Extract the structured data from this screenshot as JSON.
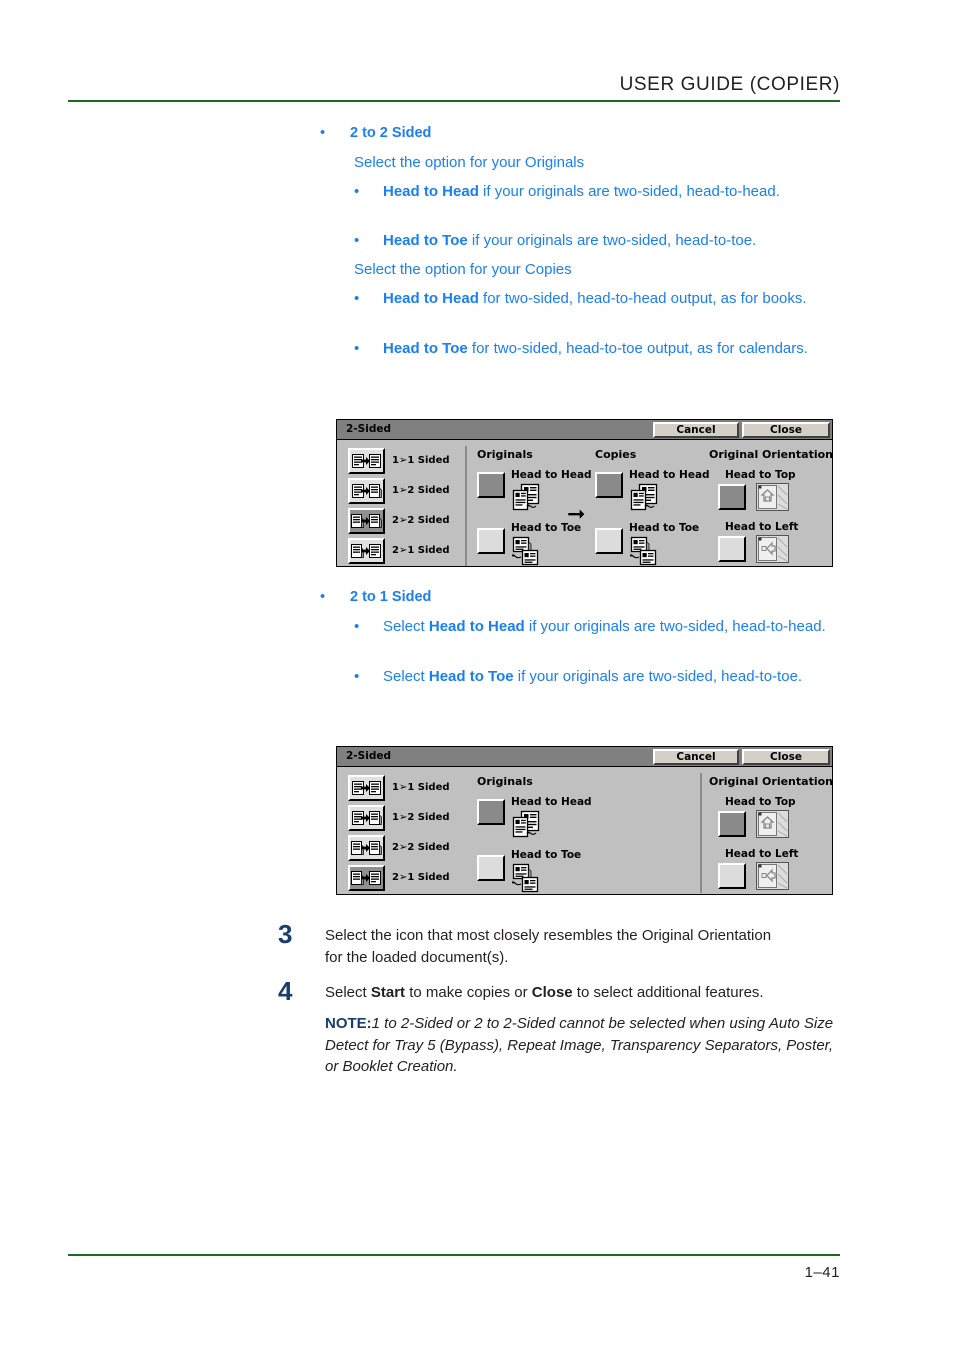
{
  "header": {
    "title": "USER GUIDE (COPIER)"
  },
  "footer": {
    "page_number": "1–41"
  },
  "content": {
    "section1": {
      "bullet": "•",
      "heading": "2 to 2 Sided",
      "originals_intro": "Select the option for your Originals",
      "originals_items": [
        {
          "bullet": "•",
          "bold": "Head to Head",
          "rest": " if your originals are two-sided, head-to-head."
        },
        {
          "bullet": "•",
          "bold": "Head to Toe",
          "rest": " if your originals are two-sided, head-to-toe."
        }
      ],
      "copies_intro": "Select the option for your Copies",
      "copies_items": [
        {
          "bullet": "•",
          "bold": "Head to Head",
          "rest": " for two-sided, head-to-head output, as for books."
        },
        {
          "bullet": "•",
          "bold": "Head to Toe",
          "rest": " for two-sided, head-to-toe output, as for calendars."
        }
      ]
    },
    "section2": {
      "bullet": "•",
      "heading": "2 to 1 Sided",
      "items": [
        {
          "bullet": "•",
          "pre": "Select ",
          "bold": "Head to Head",
          "rest": " if your originals are two-sided, head-to-head."
        },
        {
          "bullet": "•",
          "pre": "Select ",
          "bold": "Head to Toe",
          "rest": " if your originals are two-sided, head-to-toe."
        }
      ]
    },
    "steps": [
      {
        "number": "3",
        "text": "Select the icon that most closely resembles the Original Orientation for the loaded document(s)."
      },
      {
        "number": "4",
        "pre": "Select ",
        "bold1": "Start",
        "mid": " to make copies or ",
        "bold2": "Close",
        "post": " to select additional features.",
        "note_label": "NOTE:",
        "note_text": "1 to 2-Sided or 2 to 2-Sided cannot be selected when using Auto Size Detect for Tray 5 (Bypass), Repeat Image, Transparency Separators, Poster, or Booklet Creation."
      }
    ]
  },
  "panel1": {
    "title": "2-Sided",
    "cancel_label": "Cancel",
    "close_label": "Close",
    "modes": [
      {
        "label": "1➢1 Sided",
        "selected": false
      },
      {
        "label": "1➢2 Sided",
        "selected": false
      },
      {
        "label": "2➢2 Sided",
        "selected": true
      },
      {
        "label": "2➢1 Sided",
        "selected": false
      }
    ],
    "originals_header": "Originals",
    "copies_header": "Copies",
    "orientation_header": "Original Orientation",
    "originals_options": [
      {
        "label": "Head to Head",
        "selected": true
      },
      {
        "label": "Head to Toe",
        "selected": false
      }
    ],
    "copies_options": [
      {
        "label": "Head to Head",
        "selected": true
      },
      {
        "label": "Head to Toe",
        "selected": false
      }
    ],
    "orientation_options": [
      {
        "label": "Head to Top",
        "selected": true
      },
      {
        "label": "Head to Left",
        "selected": false
      }
    ]
  },
  "panel2": {
    "title": "2-Sided",
    "cancel_label": "Cancel",
    "close_label": "Close",
    "modes": [
      {
        "label": "1➢1 Sided",
        "selected": false
      },
      {
        "label": "1➢2 Sided",
        "selected": false
      },
      {
        "label": "2➢2 Sided",
        "selected": false
      },
      {
        "label": "2➢1 Sided",
        "selected": true
      }
    ],
    "originals_header": "Originals",
    "orientation_header": "Original Orientation",
    "originals_options": [
      {
        "label": "Head to Head",
        "selected": true
      },
      {
        "label": "Head to Toe",
        "selected": false
      }
    ],
    "orientation_options": [
      {
        "label": "Head to Top",
        "selected": true
      },
      {
        "label": "Head to Left",
        "selected": false
      }
    ]
  },
  "colors": {
    "link_blue": "#1a7ff0",
    "rule_green": "#1a6b1f",
    "step_navy": "#1b3c6e",
    "panel_gray": "#c0c0c0",
    "titlebar_gray": "#808080"
  }
}
